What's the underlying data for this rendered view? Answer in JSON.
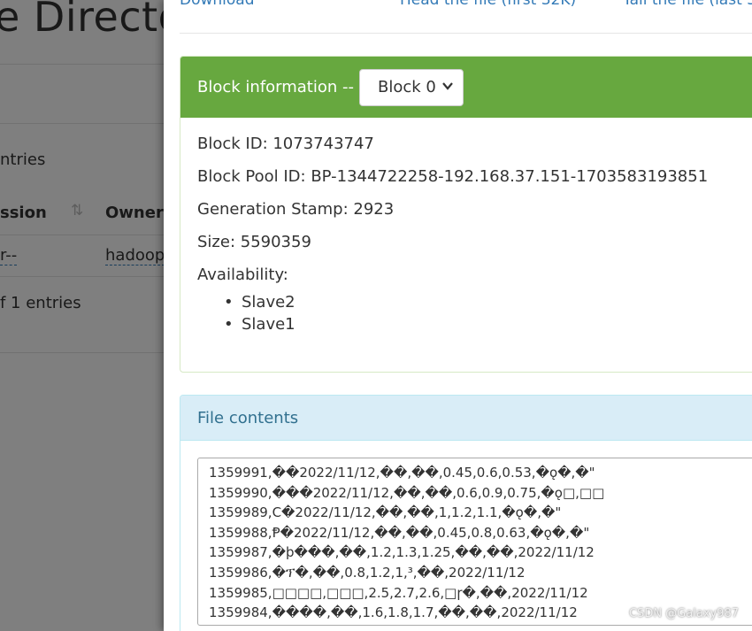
{
  "background": {
    "title": "e Director",
    "entries_text": "ntries",
    "col_permission": "ssion",
    "col_owner": "Owner",
    "row_permission": "r--",
    "row_owner": "hadoop",
    "footer_text": "f 1 entries"
  },
  "modal": {
    "links": [
      "Download",
      "Head the file (first 32K)",
      "Tail the file (last 32"
    ],
    "block_info": {
      "heading": "Block information --",
      "selected_block": "Block 0",
      "block_id": "Block ID: 1073743747",
      "block_pool_id": "Block Pool ID: BP-1344722258-192.168.37.151-1703583193851",
      "generation_stamp": "Generation Stamp: 2923",
      "size": "Size: 5590359",
      "availability_label": "Availability:",
      "nodes": [
        "Slave2",
        "Slave1"
      ]
    },
    "file_contents": {
      "heading": "File contents",
      "lines": [
        "1359991,��2022/11/12,��,��,0.45,0.6,0.53,�ǫ�,�\"",
        "1359990,���2022/11/12,��,��,0.6,0.9,0.75,�ǫ□,□□",
        "1359989,C�2022/11/12,��,��,1,1.2,1.1,�ǫ�,�\"",
        "1359988,Ᵽ�2022/11/12,��,��,0.45,0.8,0.63,�ǫ�,�\"",
        "1359987,�þ���,��,1.2,1.3,1.25,��,��,2022/11/12",
        "1359986,�ፕ�,��,0.8,1.2,1,³,��,2022/11/12",
        "1359985,□□□□,□□□,2.5,2.7,2.6,□ɼ�,��,2022/11/12",
        "1359984,����,��,1.6,1.8,1.7,��,��,2022/11/12"
      ]
    }
  },
  "watermark": "CSDN @Galaxy987",
  "colors": {
    "success_heading": "#67a83f",
    "info_heading": "#d9edf7",
    "link": "#337ab7"
  }
}
